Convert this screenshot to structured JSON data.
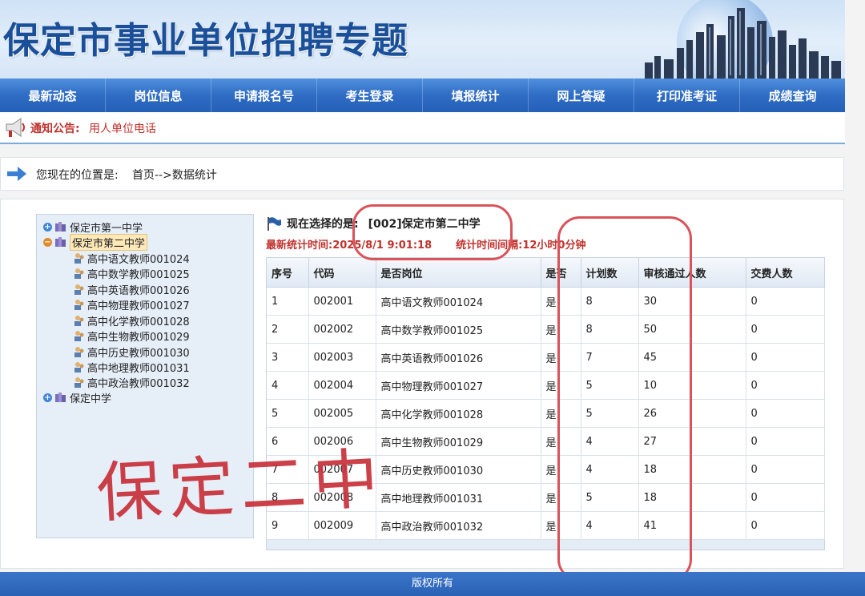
{
  "banner": {
    "title": "保定市事业单位招聘专题"
  },
  "nav": {
    "items": [
      "最新动态",
      "岗位信息",
      "申请报名号",
      "考生登录",
      "填报统计",
      "网上答疑",
      "打印准考证",
      "成绩查询"
    ]
  },
  "notice": {
    "label": "通知公告:",
    "text": "用人单位电话"
  },
  "breadcrumb": {
    "label": "您现在的位置是:",
    "path": "首页-->数据统计"
  },
  "tree": {
    "nodes": [
      {
        "label": "保定市第一中学",
        "expanded": false
      },
      {
        "label": "保定市第二中学",
        "expanded": true,
        "selected": true,
        "children": [
          "高中语文教师001024",
          "高中数学教师001025",
          "高中英语教师001026",
          "高中物理教师001027",
          "高中化学教师001028",
          "高中生物教师001029",
          "高中历史教师001030",
          "高中地理教师001031",
          "高中政治教师001032"
        ]
      },
      {
        "label": "保定中学",
        "expanded": false
      }
    ]
  },
  "selection": {
    "label": "现在选择的是:",
    "value": "[002]保定市第二中学"
  },
  "stats": {
    "time_label": "最新统计时间:",
    "time_value": "2025/8/1 9:01:18",
    "interval_label": "统计时间间隔:",
    "interval_value": "12小时0分钟"
  },
  "table": {
    "headers": [
      "序号",
      "代码",
      "是否岗位",
      "是否",
      "计划数",
      "审核通过人数",
      "交费人数"
    ],
    "rows": [
      [
        "1",
        "002001",
        "高中语文教师001024",
        "是",
        "8",
        "30",
        "0"
      ],
      [
        "2",
        "002002",
        "高中数学教师001025",
        "是",
        "8",
        "50",
        "0"
      ],
      [
        "3",
        "002003",
        "高中英语教师001026",
        "是",
        "7",
        "45",
        "0"
      ],
      [
        "4",
        "002004",
        "高中物理教师001027",
        "是",
        "5",
        "10",
        "0"
      ],
      [
        "5",
        "002005",
        "高中化学教师001028",
        "是",
        "5",
        "26",
        "0"
      ],
      [
        "6",
        "002006",
        "高中生物教师001029",
        "是",
        "4",
        "27",
        "0"
      ],
      [
        "7",
        "002007",
        "高中历史教师001030",
        "是",
        "4",
        "18",
        "0"
      ],
      [
        "8",
        "002008",
        "高中地理教师001031",
        "是",
        "5",
        "18",
        "0"
      ],
      [
        "9",
        "002009",
        "高中政治教师001032",
        "是",
        "4",
        "41",
        "0"
      ]
    ]
  },
  "annotation": {
    "handwriting": "保定二中"
  },
  "footer": {
    "text": "版权所有"
  },
  "colors": {
    "nav_blue": "#2f6cc4",
    "banner_title": "#1a4f99",
    "accent_red": "#c0312c",
    "annotation_red": "#d9535a"
  }
}
